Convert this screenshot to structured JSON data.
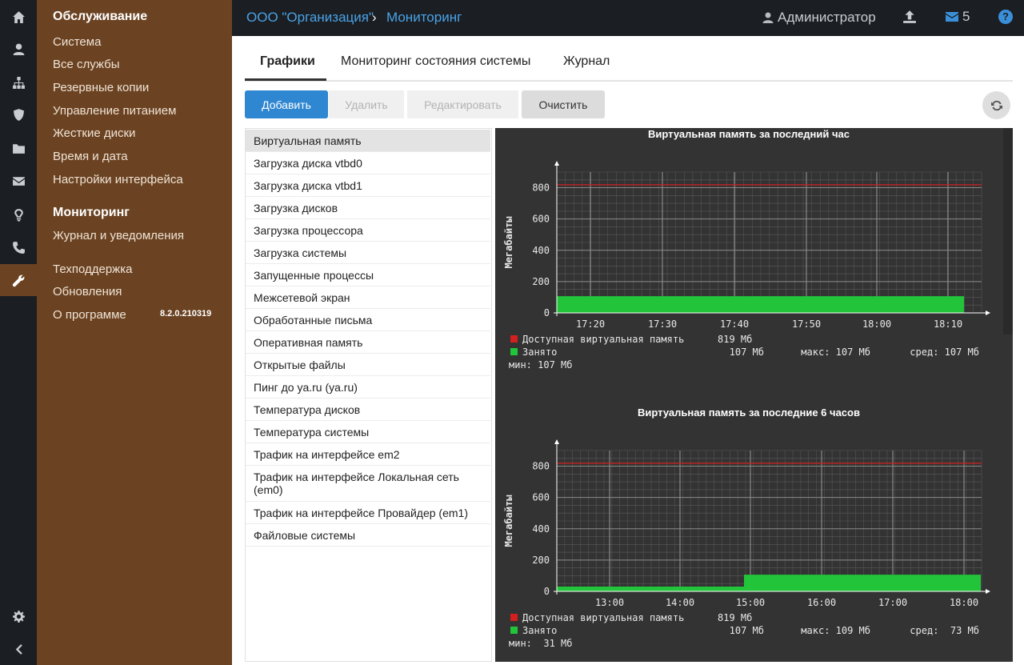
{
  "topbar": {
    "crumb_org": "ООО \"Организация\"",
    "crumb_sep": "›",
    "crumb_page": "Мониторинг",
    "user": "Администратор",
    "mail_count": "5",
    "help": "?"
  },
  "nav": {
    "section1": "Обслуживание",
    "items1": [
      "Система",
      "Все службы",
      "Резервные копии",
      "Управление питанием",
      "Жесткие диски",
      "Время и дата",
      "Настройки интерфейса"
    ],
    "section2": "Мониторинг",
    "items2": [
      "Журнал и уведомления"
    ],
    "items3": [
      "Техподдержка",
      "Обновления",
      "О программе"
    ],
    "version": "8.2.0.210319"
  },
  "tabs": [
    "Графики",
    "Мониторинг состояния системы",
    "Журнал"
  ],
  "toolbar": {
    "add": "Добавить",
    "delete": "Удалить",
    "edit": "Редактировать",
    "clear": "Очистить"
  },
  "list": [
    "Виртуальная память",
    "Загрузка диска vtbd0",
    "Загрузка диска vtbd1",
    "Загрузка дисков",
    "Загрузка процессора",
    "Загрузка системы",
    "Запущенные процессы",
    "Межсетевой экран",
    "Обработанные письма",
    "Оперативная память",
    "Открытые файлы",
    "Пинг до ya.ru (ya.ru)",
    "Температура дисков",
    "Температура системы",
    "Трафик на интерфейсе em2",
    "Трафик на интерфейсе Локальная сеть (em0)",
    "Трафик на интерфейсе Провайдер (em1)",
    "Файловые системы"
  ],
  "colors": {
    "accent": "#2f86d1",
    "nav_bg": "#6b4322",
    "used": "#22c43a",
    "available": "#d21f1f"
  },
  "chart_data": [
    {
      "type": "area",
      "title": "Виртуальная память за последний час",
      "ylabel": "Мегабайты",
      "ylim": [
        0,
        900
      ],
      "yticks": [
        "0",
        "200",
        "400",
        "600",
        "800"
      ],
      "xticks": [
        "17:20",
        "17:30",
        "17:40",
        "17:50",
        "18:00",
        "18:10"
      ],
      "series": [
        {
          "name": "Доступная виртуальная память",
          "values": [
            819,
            819
          ]
        },
        {
          "name": "Занято",
          "values": [
            107,
            107
          ]
        }
      ],
      "legend": {
        "avail_label": "Доступная виртуальная память",
        "avail_value": "819 Мб",
        "used_label": "Занято",
        "used_value": "107 Мб",
        "max": "макс: 107 Мб",
        "avg": "сред: 107 Мб",
        "min": "мин: 107 Мб"
      }
    },
    {
      "type": "area",
      "title": "Виртуальная память за последние 6 часов",
      "ylabel": "Мегабайты",
      "ylim": [
        0,
        900
      ],
      "yticks": [
        "0",
        "200",
        "400",
        "600",
        "800"
      ],
      "xticks": [
        "13:00",
        "14:00",
        "15:00",
        "16:00",
        "17:00",
        "18:00"
      ],
      "series": [
        {
          "name": "Доступная виртуальная память",
          "values": [
            819,
            819,
            819,
            819,
            819,
            819,
            819
          ]
        },
        {
          "name": "Занято",
          "values": [
            31,
            31,
            31,
            107,
            107,
            107,
            107
          ]
        }
      ],
      "legend": {
        "avail_label": "Доступная виртуальная память",
        "avail_value": "819 Мб",
        "used_label": "Занято",
        "used_value": "107 Мб",
        "max": "макс: 109 Мб",
        "avg": "сред:  73 Мб",
        "min": "мин:  31 Мб"
      }
    }
  ]
}
